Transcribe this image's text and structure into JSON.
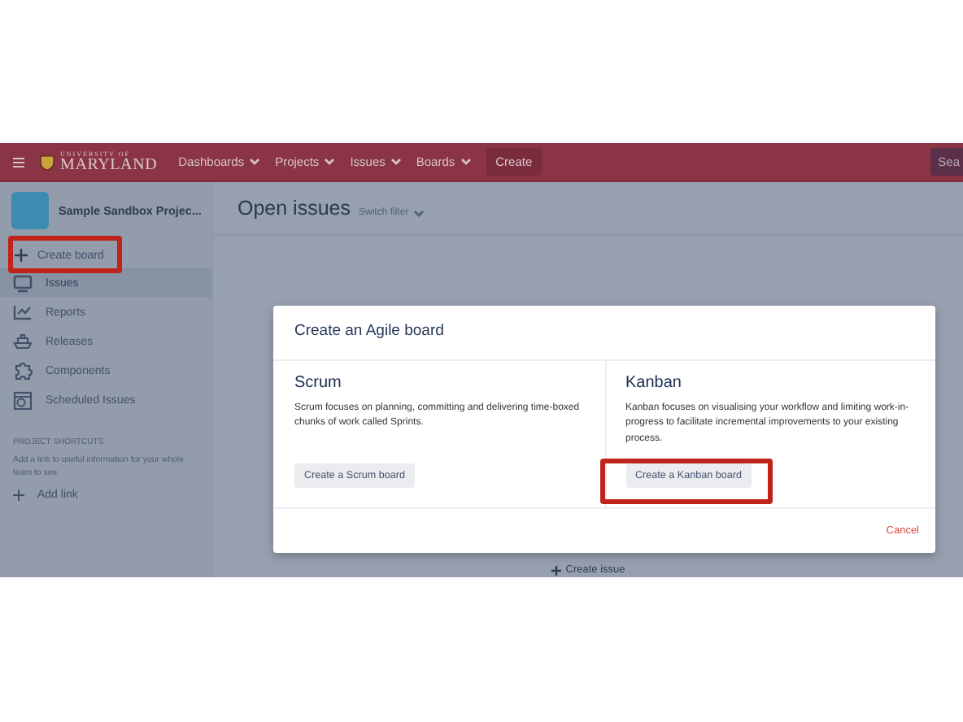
{
  "nav": {
    "logo_top": "UNIVERSITY OF",
    "logo_main": "MARYLAND",
    "items": [
      {
        "label": "Dashboards"
      },
      {
        "label": "Projects"
      },
      {
        "label": "Issues"
      },
      {
        "label": "Boards"
      }
    ],
    "create": "Create",
    "search": "Sea"
  },
  "sidebar": {
    "project": "Sample Sandbox Projec...",
    "create_board": "Create board",
    "items": [
      {
        "label": "Issues",
        "selected": true,
        "kind": "issues"
      },
      {
        "label": "Reports",
        "selected": false,
        "kind": "reports"
      },
      {
        "label": "Releases",
        "selected": false,
        "kind": "releases"
      },
      {
        "label": "Components",
        "selected": false,
        "kind": "components"
      },
      {
        "label": "Scheduled Issues",
        "selected": false,
        "kind": "scheduled"
      }
    ],
    "shortcuts_heading": "PROJECT SHORTCUTS",
    "shortcuts_text": "Add a link to useful information for your whole team to see.",
    "add_link": "Add link"
  },
  "main": {
    "title": "Open issues",
    "switch_filter": "Switch filter",
    "create_issue": "Create issue"
  },
  "dialog": {
    "title": "Create an Agile board",
    "options": [
      {
        "title": "Scrum",
        "description": "Scrum focuses on planning, committing and delivering time-boxed chunks of work called Sprints.",
        "button": "Create a Scrum board"
      },
      {
        "title": "Kanban",
        "description": "Kanban focuses on visualising your workflow and limiting work-in-progress to facilitate incremental improvements to your existing process.",
        "button": "Create a Kanban board"
      }
    ],
    "cancel": "Cancel"
  }
}
